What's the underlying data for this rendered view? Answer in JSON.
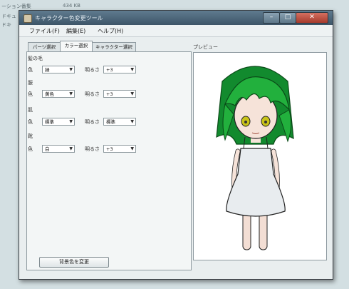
{
  "background_window": {
    "line1": "ーション番集",
    "line2": "ドキュ",
    "line3": "ドキ",
    "size": "434 KB"
  },
  "window": {
    "title": "キャラクター色変更ツール",
    "buttons": {
      "minimize": "–",
      "maximize": "□",
      "close": "✕"
    }
  },
  "menu": {
    "file": "ファイル(F)",
    "edit": "編集(E)",
    "help": "ヘルプ(H)"
  },
  "tabs": [
    "パーツ選択",
    "カラー選択",
    "キャラクター選択"
  ],
  "active_tab": "カラー選択",
  "color_settings": [
    {
      "section": "髪の毛",
      "color_label": "色",
      "color_value": "緑",
      "brightness_label": "明るさ",
      "brightness_value": "+3"
    },
    {
      "section": "服",
      "color_label": "色",
      "color_value": "黄色",
      "brightness_label": "明るさ",
      "brightness_value": "+3"
    },
    {
      "section": "肌",
      "color_label": "色",
      "color_value": "標準",
      "brightness_label": "明るさ",
      "brightness_value": "標準"
    },
    {
      "section": "靴",
      "color_label": "色",
      "color_value": "白",
      "brightness_label": "明るさ",
      "brightness_value": "+3"
    }
  ],
  "change_bg_button": "背景色を変更",
  "preview": {
    "label": "プレビュー"
  },
  "colors": {
    "hair": "#1fae3a",
    "hair_dark": "#0e6e24",
    "dress": "#e8ecef",
    "skin": "#f6e3d9",
    "eyes": "#c8c218"
  }
}
